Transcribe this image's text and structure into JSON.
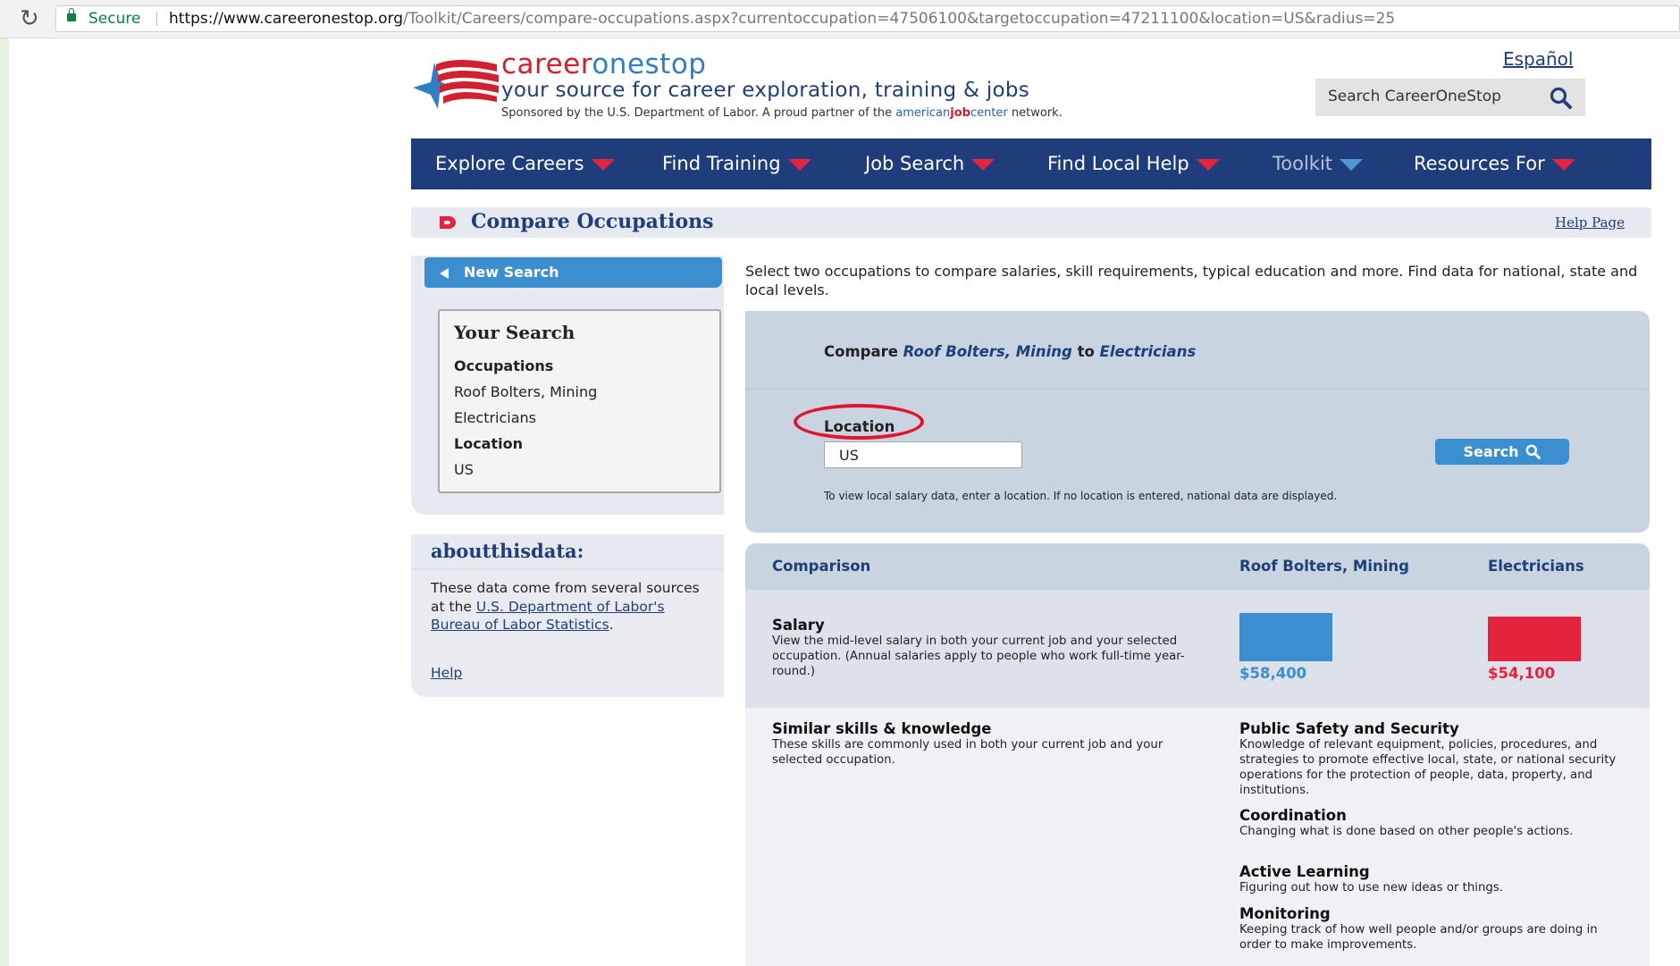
{
  "browser": {
    "secure_label": "Secure",
    "url_host": "https://www.careeronestop.org",
    "url_path": "/Toolkit/Careers/compare-occupations.aspx?currentoccupation=47506100&targetoccupation=47211100&location=US&radius=25"
  },
  "header": {
    "brand_career": "career",
    "brand_one": "one",
    "brand_stop": "stop",
    "tagline": "your source for career exploration, training & jobs",
    "sponsor_prefix": "Sponsored by the U.S. Department of Labor. A proud partner of the ",
    "sponsor_ajc_a": "american",
    "sponsor_ajc_b": "job",
    "sponsor_ajc_c": "center",
    "sponsor_suffix": " network.",
    "espanol": "Español",
    "search_placeholder": "Search CareerOneStop"
  },
  "nav": {
    "items": [
      "Explore Careers",
      "Find Training",
      "Job Search",
      "Find Local Help",
      "Toolkit",
      "Resources For"
    ]
  },
  "title": {
    "text": "Compare Occupations",
    "help": "Help Page"
  },
  "sidebar": {
    "new_search": "New Search",
    "your_search_title": "Your Search",
    "occupations_label": "Occupations",
    "occupation_1": "Roof Bolters, Mining",
    "occupation_2": "Electricians",
    "location_label": "Location",
    "location_value": "US",
    "about_title": "aboutthisdata:",
    "about_text_1": "These data come from several sources at the ",
    "about_link": "U.S. Department of Labor's Bureau of Labor Statistics",
    "about_text_2": ".",
    "about_help": "Help"
  },
  "main": {
    "intro": "Select two occupations to compare salaries, skill requirements, typical education and more. Find data for national, state and local levels.",
    "compare_word": "Compare",
    "compare_occ_1": "Roof Bolters, Mining",
    "compare_to": "to",
    "compare_occ_2": "Electricians",
    "location_label": "Location",
    "location_value": "US",
    "search_button": "Search",
    "location_note": "To view local salary data, enter a location. If no location is entered, national data are displayed."
  },
  "comparison": {
    "col_comparison": "Comparison",
    "col_occ_1": "Roof Bolters, Mining",
    "col_occ_2": "Electricians",
    "salary_head": "Salary",
    "salary_desc": "View the mid-level salary in both your current job and your selected occupation. (Annual salaries apply to people who work full-time year-round.)",
    "salary_1": "$58,400",
    "salary_2": "$54,100",
    "salary_1_value": 58400,
    "salary_2_value": 54100,
    "salary_1_color": "#3b8fd1",
    "salary_2_color": "#e4233e",
    "skills_head": "Similar skills & knowledge",
    "skills_desc": "These skills are commonly used in both your current job and your selected occupation.",
    "skills": [
      {
        "name": "Public Safety and Security",
        "desc": "Knowledge of relevant equipment, policies, procedures, and strategies to promote effective local, state, or national security operations for the protection of people, data, property, and institutions."
      },
      {
        "name": "Coordination",
        "desc": "Changing what is done based on other people's actions."
      },
      {
        "name": "Active Learning",
        "desc": "Figuring out how to use new ideas or things."
      },
      {
        "name": "Monitoring",
        "desc": "Keeping track of how well people and/or groups are doing in order to make improvements."
      }
    ]
  }
}
